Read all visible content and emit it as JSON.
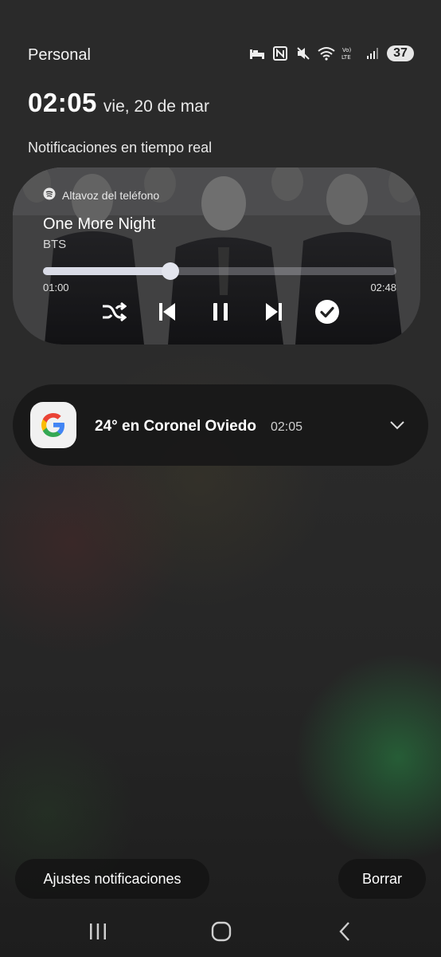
{
  "status_bar": {
    "carrier": "Personal",
    "battery": "37",
    "icons": [
      "sleep-mode-icon",
      "nfc-icon",
      "mute-icon",
      "wifi-icon",
      "volte-icon",
      "signal-icon"
    ],
    "volte_label": "Vo) LTE"
  },
  "header": {
    "time": "02:05",
    "date": "vie, 20 de mar"
  },
  "section_title": "Notificaciones en tiempo real",
  "media_player": {
    "source_icon": "spotify-icon",
    "source_label": "Altavoz del teléfono",
    "track_title": "One More Night",
    "artist": "BTS",
    "elapsed": "01:00",
    "duration": "02:48",
    "progress_fraction": 0.36,
    "controls": [
      "shuffle-icon",
      "previous-icon",
      "pause-icon",
      "next-icon",
      "check-icon"
    ]
  },
  "notification": {
    "app_icon": "google-icon",
    "title": "24° en Coronel Oviedo",
    "time": "02:05"
  },
  "footer": {
    "settings_label": "Ajustes notificaciones",
    "clear_label": "Borrar"
  },
  "nav": [
    "recents-icon",
    "home-icon",
    "back-icon"
  ],
  "colors": {
    "background": "#2a2a2a",
    "card": "#181818",
    "progress_fill": "#d9dbe6"
  }
}
